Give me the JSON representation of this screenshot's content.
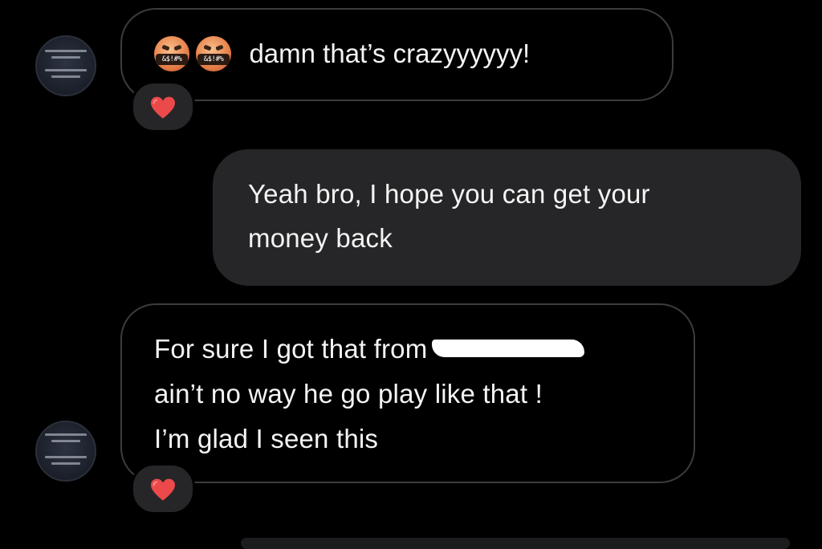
{
  "messages": [
    {
      "id": "msg1",
      "direction": "incoming",
      "emojis": [
        "angry-face-with-symbols",
        "angry-face-with-symbols"
      ],
      "emoji_symbols": "&$!#%",
      "text": "damn that’s crazyyyyyy!",
      "reaction": "heart"
    },
    {
      "id": "msg2",
      "direction": "outgoing",
      "lines": [
        "Yeah bro, I hope you can get your",
        "money back"
      ]
    },
    {
      "id": "msg3",
      "direction": "incoming",
      "lines": [
        "For sure I got that from",
        "ain’t no way he go play like that !",
        "I’m glad I seen this"
      ],
      "redacted_after_first_line": true,
      "reaction": "heart"
    }
  ],
  "colors": {
    "background": "#000000",
    "incoming_border": "#3c3c3e",
    "outgoing_bubble": "#262628",
    "text": "#f4f4f4",
    "heart": "#ec4a4a"
  },
  "icons": {
    "reaction": "heart-icon",
    "avatar": "avatar"
  }
}
